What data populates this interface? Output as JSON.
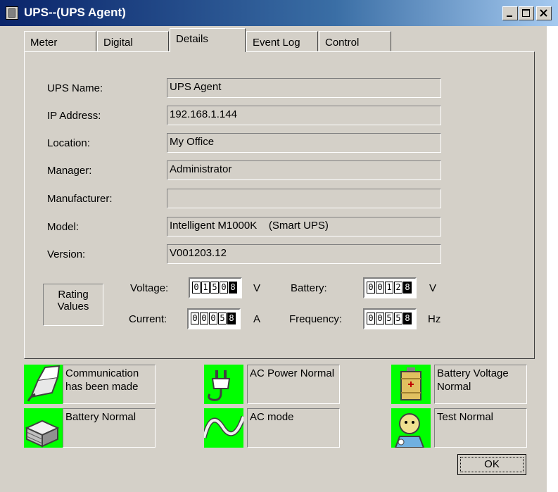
{
  "window": {
    "title": "UPS--(UPS Agent)"
  },
  "tabs": [
    {
      "label": "Meter"
    },
    {
      "label": "Digital"
    },
    {
      "label": "Details"
    },
    {
      "label": "Event Log"
    },
    {
      "label": "Control"
    }
  ],
  "active_tab": "Details",
  "details": {
    "ups_name": {
      "label": "UPS Name:",
      "value": "UPS Agent"
    },
    "ip_address": {
      "label": "IP Address:",
      "value": "192.168.1.144"
    },
    "location": {
      "label": "Location:",
      "value": "My Office"
    },
    "manager": {
      "label": "Manager:",
      "value": "Administrator"
    },
    "manufacturer": {
      "label": "Manufacturer:",
      "value": ""
    },
    "model": {
      "label": "Model:",
      "value": "Intelligent M1000K    (Smart UPS)"
    },
    "version": {
      "label": "Version:",
      "value": "V001203.12"
    }
  },
  "rating": {
    "title_line1": "Rating",
    "title_line2": "Values",
    "voltage": {
      "label": "Voltage:",
      "digits": [
        "0",
        "1",
        "5",
        "0",
        "8"
      ],
      "unit": "V"
    },
    "current": {
      "label": "Current:",
      "digits": [
        "0",
        "0",
        "0",
        "5",
        "8"
      ],
      "unit": "A"
    },
    "battery": {
      "label": "Battery:",
      "digits": [
        "0",
        "0",
        "1",
        "2",
        "8"
      ],
      "unit": "V"
    },
    "frequency": {
      "label": "Frequency:",
      "digits": [
        "0",
        "0",
        "5",
        "5",
        "8"
      ],
      "unit": "Hz"
    }
  },
  "status": [
    {
      "icon": "communication-cable-icon",
      "line1": "Communication",
      "line2": "has been made"
    },
    {
      "icon": "ac-plug-icon",
      "line1": "AC Power Normal",
      "line2": ""
    },
    {
      "icon": "battery-voltage-icon",
      "line1": "Battery Voltage",
      "line2": "Normal"
    },
    {
      "icon": "battery-stack-icon",
      "line1": "Battery Normal",
      "line2": ""
    },
    {
      "icon": "sine-wave-icon",
      "line1": "AC mode",
      "line2": ""
    },
    {
      "icon": "test-person-icon",
      "line1": "Test Normal",
      "line2": ""
    }
  ],
  "status_color": "#00ff00",
  "buttons": {
    "ok": "OK"
  }
}
